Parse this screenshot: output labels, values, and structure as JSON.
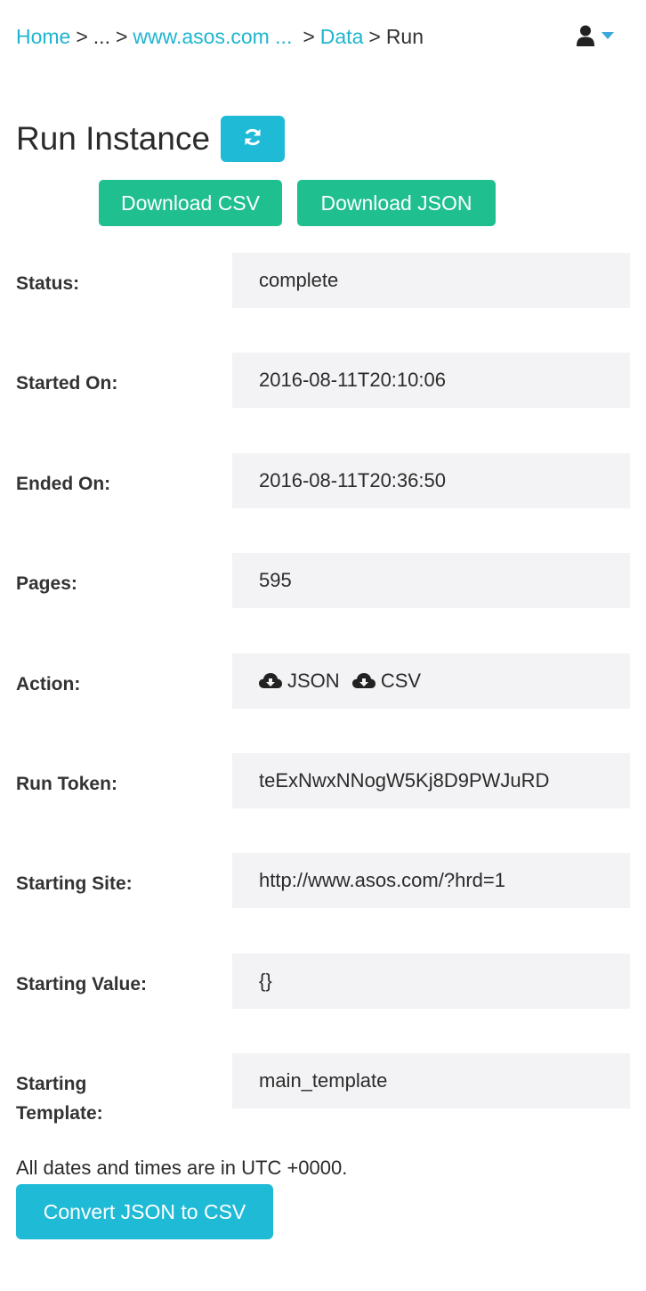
{
  "breadcrumb": {
    "home": "Home",
    "sep": ">",
    "ellipsis": "...",
    "site": "www.asos.com ...",
    "data": "Data",
    "current": "Run"
  },
  "user_menu": {
    "icon": "user-icon",
    "caret": "caret-down-icon"
  },
  "title": "Run Instance",
  "refresh_icon": "refresh-icon",
  "buttons": {
    "download_csv": "Download CSV",
    "download_json": "Download JSON",
    "convert": "Convert JSON to CSV"
  },
  "details": {
    "status": {
      "label": "Status:",
      "value": "complete"
    },
    "started_on": {
      "label": "Started On:",
      "value": "2016-08-11T20:10:06"
    },
    "ended_on": {
      "label": "Ended On:",
      "value": "2016-08-11T20:36:50"
    },
    "pages": {
      "label": "Pages:",
      "value": "595"
    },
    "action": {
      "label": "Action:",
      "json": "JSON",
      "csv": "CSV",
      "icon": "cloud-download-icon"
    },
    "run_token": {
      "label": "Run Token:",
      "value": "teExNwxNNogW5Kj8D9PWJuRD"
    },
    "starting_site": {
      "label": "Starting Site:",
      "value": "http://www.asos.com/?hrd=1"
    },
    "starting_value": {
      "label": "Starting Value:",
      "value": "{}"
    },
    "starting_template": {
      "label": "Starting Template:",
      "value": "main_template"
    }
  },
  "footnote": "All dates and times are in UTC +0000.",
  "colors": {
    "accent": "#1fbad6",
    "green": "#1fbf8f",
    "link": "#1fb5d0",
    "value_bg": "#f3f3f5"
  }
}
